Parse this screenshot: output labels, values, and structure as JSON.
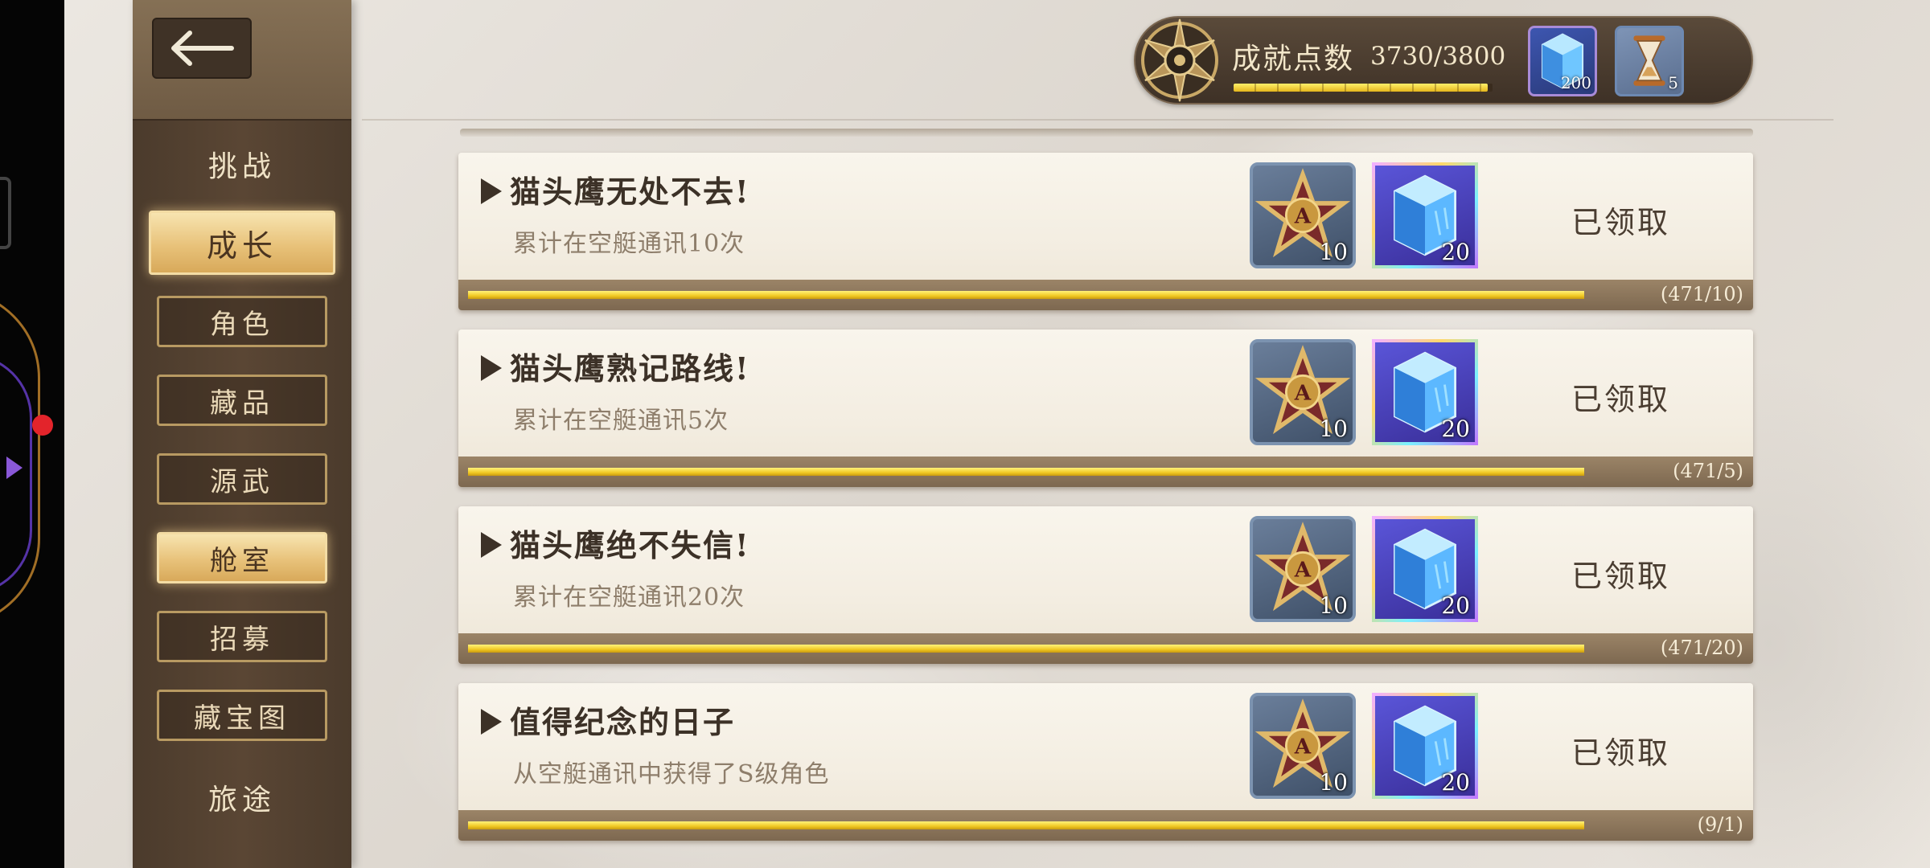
{
  "sidebar": {
    "back_icon": "back-arrow-icon",
    "headings": [
      "挑战",
      "旅途"
    ],
    "items": [
      {
        "label": "成长",
        "active": true
      },
      {
        "label": "角色",
        "active": false
      },
      {
        "label": "藏品",
        "active": false
      },
      {
        "label": "源武",
        "active": false
      },
      {
        "label": "舱室",
        "active": true
      },
      {
        "label": "招募",
        "active": false
      },
      {
        "label": "藏宝图",
        "active": false
      }
    ]
  },
  "topbar": {
    "emblem_icon": "compass-emblem-icon",
    "label": "成就点数",
    "score": "3730/3800",
    "score_fraction": 0.98,
    "currencies": [
      {
        "icon": "blue-crystal-icon",
        "count": "200"
      },
      {
        "icon": "hourglass-icon",
        "count": "5"
      }
    ]
  },
  "achievements": [
    {
      "title": "猫头鹰无处不去!",
      "desc": "累计在空艇通讯10次",
      "rewards": [
        {
          "icon": "star-medal-icon",
          "count": "10"
        },
        {
          "icon": "blue-crystal-icon",
          "count": "20"
        }
      ],
      "status": "已领取",
      "progress": "(471/10)",
      "progress_fraction": 1.0
    },
    {
      "title": "猫头鹰熟记路线!",
      "desc": "累计在空艇通讯5次",
      "rewards": [
        {
          "icon": "star-medal-icon",
          "count": "10"
        },
        {
          "icon": "blue-crystal-icon",
          "count": "20"
        }
      ],
      "status": "已领取",
      "progress": "(471/5)",
      "progress_fraction": 1.0
    },
    {
      "title": "猫头鹰绝不失信!",
      "desc": "累计在空艇通讯20次",
      "rewards": [
        {
          "icon": "star-medal-icon",
          "count": "10"
        },
        {
          "icon": "blue-crystal-icon",
          "count": "20"
        }
      ],
      "status": "已领取",
      "progress": "(471/20)",
      "progress_fraction": 1.0
    },
    {
      "title": "值得纪念的日子",
      "desc": "从空艇通讯中获得了S级角色",
      "rewards": [
        {
          "icon": "star-medal-icon",
          "count": "10"
        },
        {
          "icon": "blue-crystal-icon",
          "count": "20"
        }
      ],
      "status": "已领取",
      "progress": "(9/1)",
      "progress_fraction": 1.0
    }
  ],
  "colors": {
    "accent_gold": "#e8c27a",
    "panel_brown": "#4b3b2c",
    "progress_yellow": "#f1c924"
  }
}
